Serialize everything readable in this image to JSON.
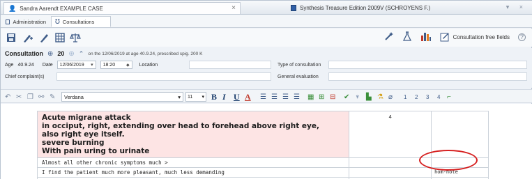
{
  "window_tabs": [
    {
      "label": "Sandra Aarendt EXAMPLE CASE",
      "icon": "person-icon",
      "close": "×"
    },
    {
      "label": "Synthesis Treasure Edition 2009V (SCHROYENS F.)",
      "icon": "book-icon"
    }
  ],
  "window_controls": "▾ ×",
  "subtabs": [
    {
      "label": "Administration",
      "icon": "id-card-icon"
    },
    {
      "label": "Consultations",
      "icon": "stethoscope-icon"
    }
  ],
  "toolbar_right": {
    "free_fields_label": "Consultation free fields"
  },
  "consultation": {
    "title": "Consultation",
    "number": "20",
    "summary": "on the 12/06/2019 at age 40.9.24, prescribed spig. 200 K",
    "age_label": "Age",
    "age_value": "40.9.24",
    "date_label": "Date",
    "date_value": "12/06/2019",
    "time_value": "18:20",
    "location_label": "Location",
    "type_label": "Type of consultation",
    "chief_label": "Chief complaint(s)",
    "general_label": "General evaluation"
  },
  "format_bar": {
    "font": "Verdana",
    "size": "11",
    "bold": "B",
    "italic": "I",
    "underline": "U",
    "color": "A",
    "levels": [
      "1",
      "2",
      "3",
      "4"
    ]
  },
  "notes": {
    "main_lines": [
      "Acute migrane attack",
      "in occiput, right, extending over head to forehead above right eye,",
      "also right eye itself.",
      "severe burning",
      "With pain uring to urinate"
    ],
    "main_grade": "4",
    "row2": "Almost all other chronic symptoms much >",
    "row3": "I find the patient much more pleasant, much less demanding",
    "row3_note": "hom-note"
  },
  "colors": {
    "highlight": "#fde4e4",
    "annotation_oval": "#d62020",
    "accent": "#3f5c88"
  }
}
